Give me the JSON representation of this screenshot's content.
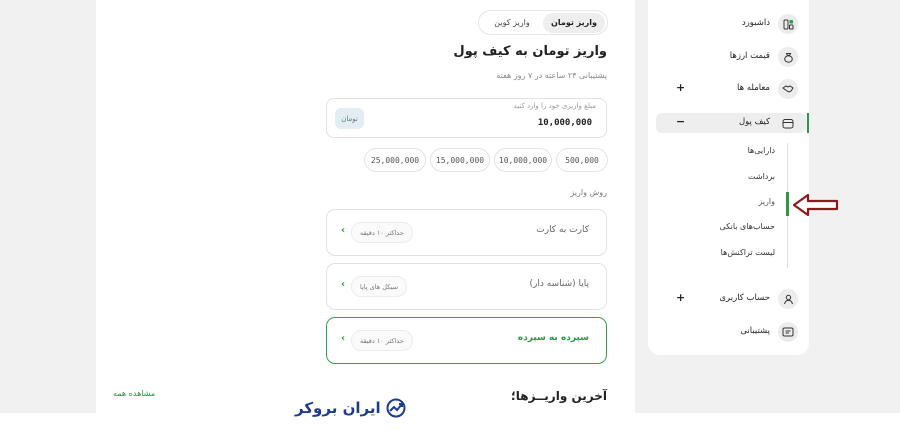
{
  "main": {
    "tabs": [
      {
        "label": "واریز کوین",
        "active": false
      },
      {
        "label": "واریز تومان",
        "active": true
      }
    ],
    "title": "واریز تومان به کیف پول",
    "subtitle": "پشتیبانی ۲۴ ساعته در ۷ روز هفته",
    "amount": {
      "hint": "مبلغ واریزی خود را وارد کنید",
      "value": "10,000,000",
      "currency": "تومان"
    },
    "quick_amounts": [
      "25,000,000",
      "15,000,000",
      "10,000,000",
      "500,000"
    ],
    "methods_label": "روش واریز",
    "methods": [
      {
        "name": "کارت به کارت",
        "tag": "حداکثر ۱۰ دقیقه",
        "selected": false
      },
      {
        "name": "پایا (شناسه دار)",
        "tag": "سیکل های پایا",
        "selected": false
      },
      {
        "name": "سپرده به سپرده",
        "tag": "حداکثر ۱۰ دقیقه",
        "selected": true
      }
    ],
    "last_deposits_title": "آخرین واریــزها؛",
    "see_all": "مشاهده همه",
    "logo_text": "ایران بروکر"
  },
  "sidebar": {
    "items": [
      {
        "label": "داشبورد",
        "icon": "dashboard-icon",
        "expandable": false
      },
      {
        "label": "قیمت ارزها",
        "icon": "coin-bag-icon",
        "expandable": false
      },
      {
        "label": "معامله ها",
        "icon": "handshake-icon",
        "expandable": true,
        "toggle": "+"
      },
      {
        "label": "کیف پول",
        "icon": "wallet-icon",
        "expandable": true,
        "toggle": "−",
        "active": true
      },
      {
        "label": "حساب کاربری",
        "icon": "user-icon",
        "expandable": true,
        "toggle": "+"
      },
      {
        "label": "پشتیبانی",
        "icon": "support-icon",
        "expandable": false
      }
    ],
    "wallet_sub_items": [
      "دارایی‌ها",
      "برداشت",
      "واریز",
      "حساب‌های بانکی",
      "لیست تراکنش‌ها"
    ]
  },
  "colors": {
    "accent_green": "#2a9a44",
    "annotation_arrow": "#8b1a1a",
    "logo_blue": "#1b3c8f"
  }
}
